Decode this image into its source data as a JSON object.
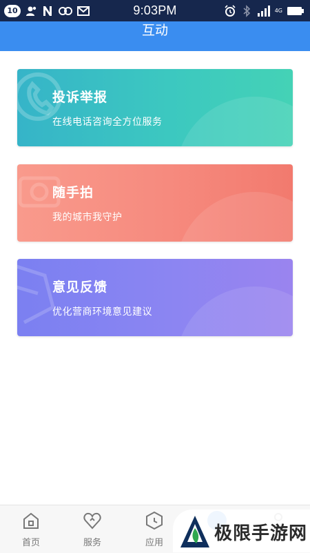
{
  "status_bar": {
    "notification_count": "10",
    "time": "9:03PM",
    "network_label": "4G",
    "icons": [
      "contacts-icon",
      "n-app-icon",
      "infinity-app-icon",
      "mail-icon",
      "alarm-icon",
      "bluetooth-icon",
      "signal-icon",
      "battery-icon"
    ]
  },
  "header": {
    "title": "互动"
  },
  "cards": [
    {
      "title": "投诉举报",
      "subtitle": "在线电话咨询全方位服务",
      "icon": "phone-icon",
      "color": "#3cc8c0"
    },
    {
      "title": "随手拍",
      "subtitle": "我的城市我守护",
      "icon": "camera-icon",
      "color": "#f68a7e"
    },
    {
      "title": "意见反馈",
      "subtitle": "优化营商环境意见建议",
      "icon": "feedback-icon",
      "color": "#8b85f2"
    }
  ],
  "bottom_nav": {
    "items": [
      {
        "label": "首页",
        "icon": "home-icon"
      },
      {
        "label": "服务",
        "icon": "heart-icon"
      },
      {
        "label": "应用",
        "icon": "apps-icon"
      },
      {
        "label": "",
        "icon": "interact-icon",
        "active": true
      },
      {
        "label": "",
        "icon": "profile-icon"
      }
    ]
  },
  "watermark": {
    "text": "极限手游网"
  },
  "colors": {
    "status_bar": "#16274d",
    "header": "#3a8df0",
    "nav_label": "#777777"
  }
}
